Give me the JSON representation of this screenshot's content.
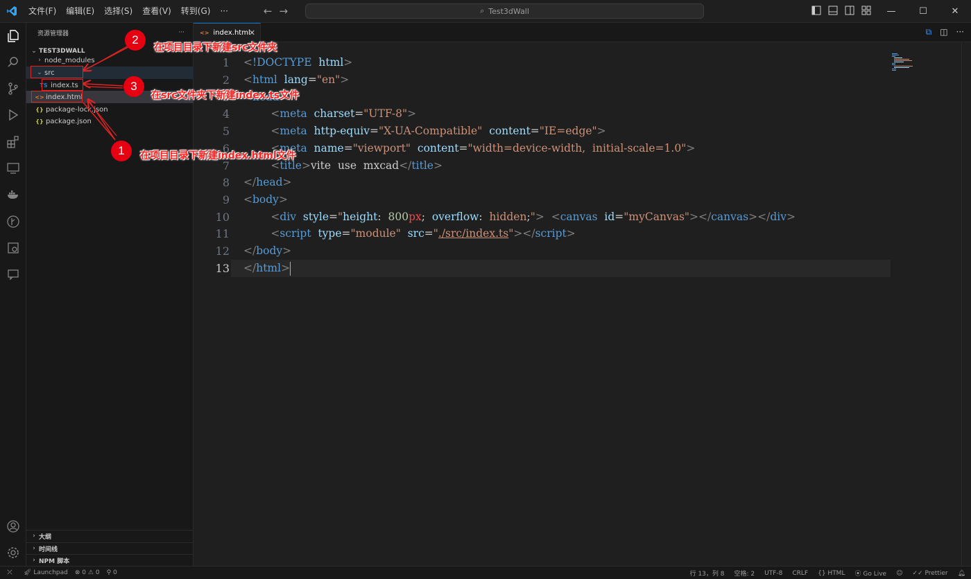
{
  "titlebar": {
    "menus": [
      "文件(F)",
      "编辑(E)",
      "选择(S)",
      "查看(V)",
      "转到(G)",
      "···"
    ],
    "search_text": "Test3dWall"
  },
  "sidebar": {
    "header": "资源管理器",
    "more": "···",
    "folder": "TEST3DWALL",
    "items": [
      {
        "label": "node_modules",
        "icon": "chevron-right"
      },
      {
        "label": "src",
        "icon": "chevron-down"
      },
      {
        "label": "index.ts",
        "icon": "TS"
      },
      {
        "label": "index.html",
        "icon": "<>"
      },
      {
        "label": "package-lock.json",
        "icon": "{}"
      },
      {
        "label": "package.json",
        "icon": "{}"
      }
    ],
    "sections": [
      "大纲",
      "时间线",
      "NPM 脚本"
    ]
  },
  "editor": {
    "tab_label": "index.html",
    "line_numbers": [
      "1",
      "2",
      "3",
      "4",
      "5",
      "6",
      "7",
      "8",
      "9",
      "10",
      "11",
      "12",
      "13"
    ],
    "current_line": "13"
  },
  "annotations": {
    "n1": "1",
    "n2": "2",
    "n3": "3",
    "text1": "在项目目录下新建index.html文件",
    "text2": "在项目目录下新建src文件夹",
    "text3": "在src文件夹下新建index.ts文件"
  },
  "statusbar": {
    "launchpad": "Launchpad",
    "errors": "0",
    "warnings": "0",
    "ports": "0",
    "position": "行 13，列 8",
    "spaces": "空格: 2",
    "encoding": "UTF-8",
    "eol": "CRLF",
    "language": "HTML",
    "golive": "Go Live",
    "prettier": "Prettier"
  },
  "colors": {
    "accent": "#0078d4",
    "annotation_red": "#e60012",
    "tag_blue": "#569cd6",
    "attr_lightblue": "#9cdcfe",
    "string_orange": "#ce9178"
  }
}
